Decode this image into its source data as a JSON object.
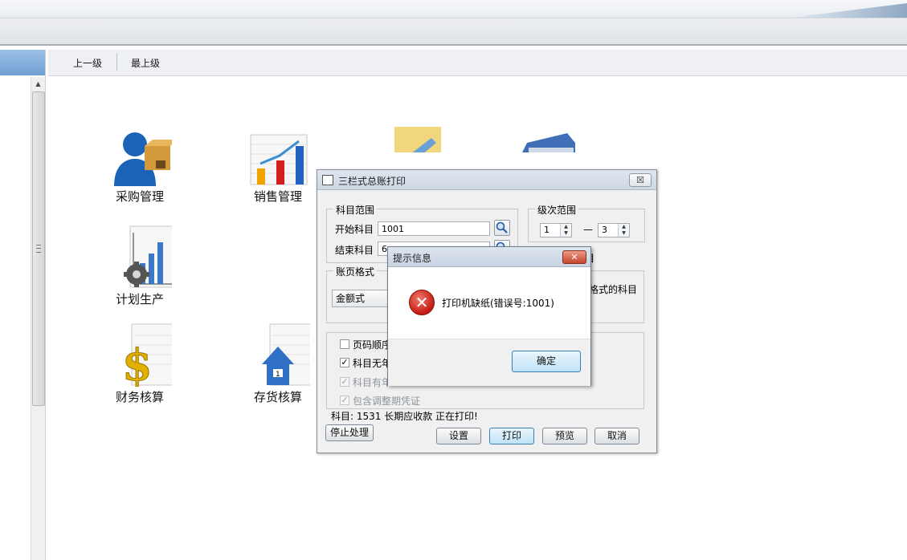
{
  "nav": {
    "up": "上一级",
    "top": "最上级"
  },
  "modules": [
    {
      "label": "采购管理",
      "icon": "purchase-person-icon"
    },
    {
      "label": "销售管理",
      "icon": "sales-chart-icon"
    },
    {
      "label": "计划生产",
      "icon": "production-gear-icon"
    },
    {
      "label": "财务核算",
      "icon": "finance-dollar-icon"
    },
    {
      "label": "存货核算",
      "icon": "inventory-house-icon"
    }
  ],
  "dialog": {
    "title": "三栏式总账打印",
    "close": "☒",
    "subject_range": {
      "legend": "科目范围",
      "start_label": "开始科目",
      "start_value": "1001",
      "end_label": "结束科目",
      "end_value": "6"
    },
    "level_range": {
      "legend": "级次范围",
      "from": "1",
      "dash": "—",
      "to": "3"
    },
    "partial_label": "目",
    "page_format": {
      "legend": "账页格式",
      "value": "金额式",
      "side_text": "格式的科目"
    },
    "options": [
      {
        "label": "页码顺序",
        "checked": false,
        "enabled": true
      },
      {
        "label": "科目无年",
        "checked": true,
        "enabled": true
      },
      {
        "label": "科目有年",
        "checked": true,
        "enabled": false
      },
      {
        "label": "包含调整期凭证",
        "checked": true,
        "enabled": false
      }
    ],
    "status": "科目: 1531 长期应收款 正在打印!",
    "buttons": {
      "stop": "停止处理",
      "settings": "设置",
      "print": "打印",
      "preview": "预览",
      "cancel": "取消"
    }
  },
  "msgbox": {
    "title": "提示信息",
    "close": "✕",
    "message": "打印机缺纸(错误号:1001)",
    "ok": "确定"
  },
  "colors": {
    "error_red": "#c31c12",
    "dialog_bg": "#f0f0f0",
    "default_button": "#3c7fb1"
  }
}
